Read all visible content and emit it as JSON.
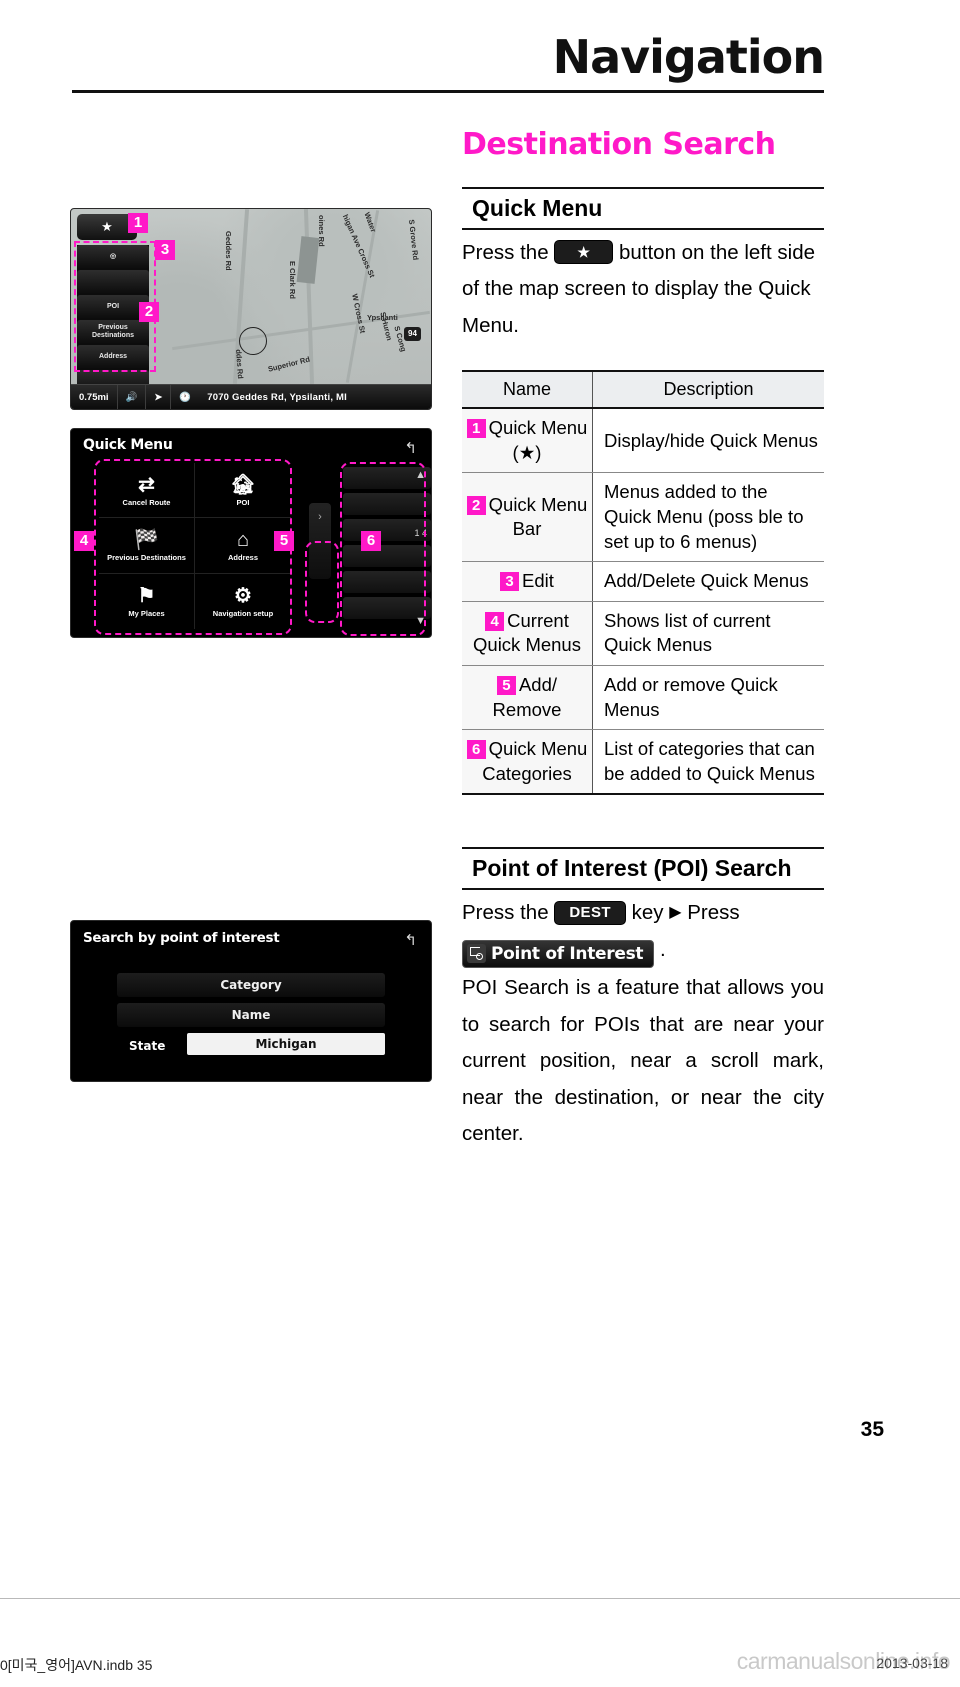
{
  "header": {
    "chapter_title": "Navigation"
  },
  "right_column": {
    "section_title": "Destination Search",
    "quick_menu": {
      "heading": "Quick Menu",
      "intro_before": "Press the",
      "star_chip": "★",
      "intro_after": "button on the left side of the map screen to display the Quick Menu.",
      "table": {
        "headers": {
          "name": "Name",
          "description": "Description"
        },
        "rows": [
          {
            "num": "1",
            "name": "Quick Menu (★)",
            "description": "Display/hide Quick Menus"
          },
          {
            "num": "2",
            "name": "Quick Menu Bar",
            "description": "Menus added to the Quick Menu (poss ble to set up to 6 menus)"
          },
          {
            "num": "3",
            "name": "Edit",
            "description": "Add/Delete Quick Menus"
          },
          {
            "num": "4",
            "name": "Current Quick Menus",
            "description": "Shows list of current Quick Menus"
          },
          {
            "num": "5",
            "name": "Add/ Remove",
            "description": "Add or remove Quick Menus"
          },
          {
            "num": "6",
            "name": "Quick Menu Categories",
            "description": "List of categories that can be added to Quick Menus"
          }
        ]
      }
    },
    "poi": {
      "heading": "Point of Interest (POI) Search",
      "press_the": "Press the",
      "dest_key": "DEST",
      "key_word": "key",
      "arrow": "▶",
      "press_word": "Press",
      "poi_button": "Point of Interest",
      "period": ".",
      "body": "POI Search is a feature that allows you to search for POIs that are near your current position, near a scroll mark, near the destination, or near the city center."
    }
  },
  "map_screenshot": {
    "star_button": "★",
    "quick_menu_bar": [
      "",
      "",
      "POI",
      "Previous Destinations",
      "Address",
      "",
      "Navigation setup"
    ],
    "map_labels": [
      "Geddes Rd",
      "E Clark Rd",
      "oines Rd",
      "higan Ave Cross St",
      "Water",
      "Ypsilanti",
      "W Cross St",
      "S Huron",
      "S Cong",
      "S Grove Rd",
      "Superior Rd",
      "ddes Rd"
    ],
    "bottom_bar": {
      "scale": "0.75mi",
      "volume_icon": "volume-icon",
      "route_icon": "route-icon",
      "clock_icon": "clock-icon",
      "address": "7070 Geddes Rd, Ypsilanti, MI"
    },
    "highway_shield": "94"
  },
  "quick_menu_screenshot": {
    "title": "Quick Menu",
    "back_icon": "↰",
    "cells": [
      {
        "icon": "⇄",
        "label": "Cancel Route"
      },
      {
        "icon": "🏚",
        "label": "POI"
      },
      {
        "icon": "🏁",
        "label": "Previous Destinations"
      },
      {
        "icon": "⌂",
        "label": "Address"
      },
      {
        "icon": "⚑",
        "label": "My Places"
      },
      {
        "icon": "⚙",
        "label": "Navigation setup"
      }
    ],
    "mid_arrow": "›",
    "page_indicator": "1 4",
    "scroll_up": "▲",
    "scroll_down": "▼"
  },
  "poi_screenshot": {
    "title": "Search by point of interest",
    "back_icon": "↰",
    "category_label": "Category",
    "name_label": "Name",
    "state_label": "State",
    "state_value": "Michigan"
  },
  "callouts": [
    {
      "id": "1"
    },
    {
      "id": "2"
    },
    {
      "id": "3"
    },
    {
      "id": "4"
    },
    {
      "id": "5"
    },
    {
      "id": "6"
    }
  ],
  "footer": {
    "page_number": "35",
    "left_text": "0[미국_영어]AVN.indb   35",
    "right_text": "2013-03-18",
    "watermark": "carmanualsonline.info"
  }
}
